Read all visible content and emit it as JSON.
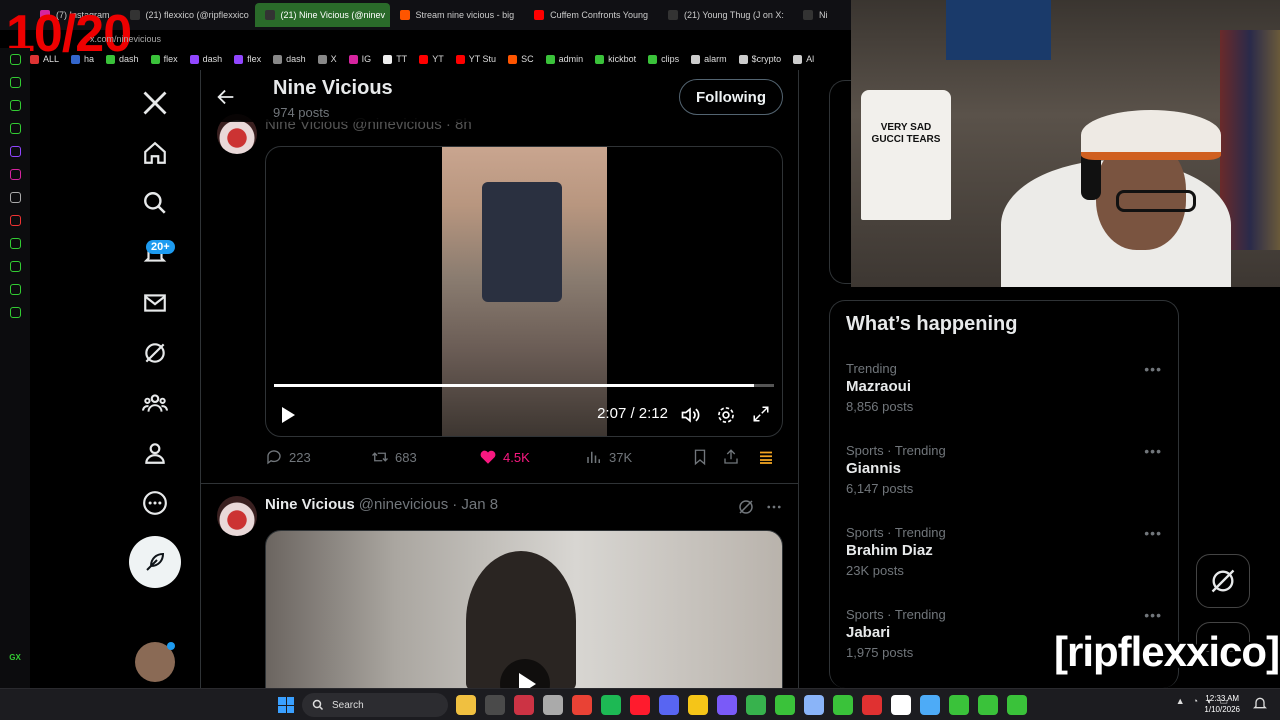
{
  "overlay": {
    "counter": "10/20",
    "streamer_name": "[ripflexxico]"
  },
  "browser": {
    "tabs": [
      {
        "label": "(7) Instagram",
        "color": "#d6249f"
      },
      {
        "label": "(21) flexxico (@ripflexxico",
        "color": "#333333"
      },
      {
        "label": "(21) Nine Vicious (@ninev",
        "color": "#333333",
        "active": true
      },
      {
        "label": "Stream nine vicious - big",
        "color": "#ff5500"
      },
      {
        "label": "Cuffem Confronts Young",
        "color": "#ff0000"
      },
      {
        "label": "(21) Young Thug (J on X:",
        "color": "#333333"
      },
      {
        "label": "Ni",
        "color": "#333333"
      }
    ],
    "url": "x.com/ninevicious",
    "bookmarks": [
      {
        "label": "ALL",
        "color": "#dd3333"
      },
      {
        "label": "ha",
        "color": "#3366cc"
      },
      {
        "label": "dash",
        "color": "#3ac23a"
      },
      {
        "label": "flex",
        "color": "#3ac23a"
      },
      {
        "label": "dash",
        "color": "#9146ff"
      },
      {
        "label": "flex",
        "color": "#9146ff"
      },
      {
        "label": "dash",
        "color": "#888888"
      },
      {
        "label": "X",
        "color": "#888888"
      },
      {
        "label": "IG",
        "color": "#d6249f"
      },
      {
        "label": "TT",
        "color": "#eeeeee"
      },
      {
        "label": "YT",
        "color": "#ff0000"
      },
      {
        "label": "YT Stu",
        "color": "#ff0000"
      },
      {
        "label": "SC",
        "color": "#ff5500"
      },
      {
        "label": "admin",
        "color": "#3ac23a"
      },
      {
        "label": "kickbot",
        "color": "#3ac23a"
      },
      {
        "label": "clips",
        "color": "#3ac23a"
      },
      {
        "label": "alarm",
        "color": "#cccccc"
      },
      {
        "label": "$crypto",
        "color": "#cccccc"
      },
      {
        "label": "Al",
        "color": "#cccccc"
      }
    ]
  },
  "nav": {
    "notifications_badge": "20+"
  },
  "profile_header": {
    "name": "Nine Vicious",
    "posts": "974 posts",
    "follow_label": "Following"
  },
  "post1": {
    "partial_header": "Nine Vicious @ninevicious · 8h",
    "video_time": "2:07 / 2:12",
    "progress": 0.96,
    "replies": "223",
    "reposts": "683",
    "likes": "4.5K",
    "views": "37K"
  },
  "post2": {
    "name": "Nine Vicious",
    "handle": "@ninevicious",
    "date": "· Jan 8"
  },
  "trends": {
    "title": "What’s happening",
    "items": [
      {
        "context": "Trending",
        "name": "Mazraoui",
        "count": "8,856 posts"
      },
      {
        "context": "Sports · Trending",
        "name": "Giannis",
        "count": "6,147 posts"
      },
      {
        "context": "Sports · Trending",
        "name": "Brahim Diaz",
        "count": "23K posts"
      },
      {
        "context": "Sports · Trending",
        "name": "Jabari",
        "count": "1,975 posts"
      }
    ]
  },
  "webcam": {
    "tshirt_text": "VERY SAD GUCCI TEARS"
  },
  "taskbar": {
    "search_label": "Search",
    "time": "12:33 AM",
    "date": "1/10/2026",
    "icon_colors": [
      "#f0c040",
      "#4a4a4a",
      "#cc3344",
      "#aaaaaa",
      "#e94235",
      "#1db954",
      "#ff1b2d",
      "#5865f2",
      "#f5c518",
      "#7a5af8",
      "#37b24d",
      "#3ac23a",
      "#8ab4f8",
      "#3ac23a",
      "#e03131",
      "#ffffff",
      "#4dabf7",
      "#3ac23a",
      "#3ac23a",
      "#3ac23a"
    ]
  },
  "colors": {
    "like": "#f91880",
    "accent": "#1d9bf0",
    "grok_icon": "#f5a623"
  }
}
